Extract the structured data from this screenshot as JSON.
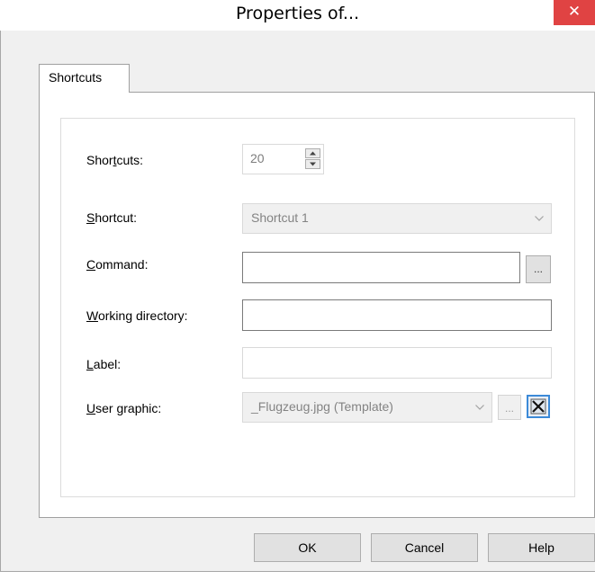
{
  "dialog": {
    "title": "Properties of...",
    "close_glyph": "✕",
    "close_color": "#e04343",
    "tab_label": "Shortcuts"
  },
  "form": {
    "shortcuts": {
      "label_pre": "Shor",
      "label_key": "t",
      "label_post": "cuts:",
      "value": "20"
    },
    "shortcut": {
      "label_pre": "",
      "label_key": "S",
      "label_post": "hortcut:",
      "value": "Shortcut 1"
    },
    "command": {
      "label_pre": "",
      "label_key": "C",
      "label_post": "ommand:",
      "value": "",
      "browse_label": "..."
    },
    "working_directory": {
      "label_pre": "",
      "label_key": "W",
      "label_post": "orking directory:",
      "value": ""
    },
    "label": {
      "label_pre": "",
      "label_key": "L",
      "label_post": "abel:",
      "value": ""
    },
    "user_graphic": {
      "label_pre": "",
      "label_key": "U",
      "label_post": "ser graphic:",
      "value": "_Flugzeug.jpg (Template)",
      "browse_label": "..."
    }
  },
  "buttons": {
    "ok": "OK",
    "cancel": "Cancel",
    "help": "Help"
  },
  "icons": {
    "spin_up": "spin-up-icon",
    "spin_down": "spin-down-icon",
    "dropdown": "chevron-down-icon",
    "clear": "clear-image-icon"
  }
}
